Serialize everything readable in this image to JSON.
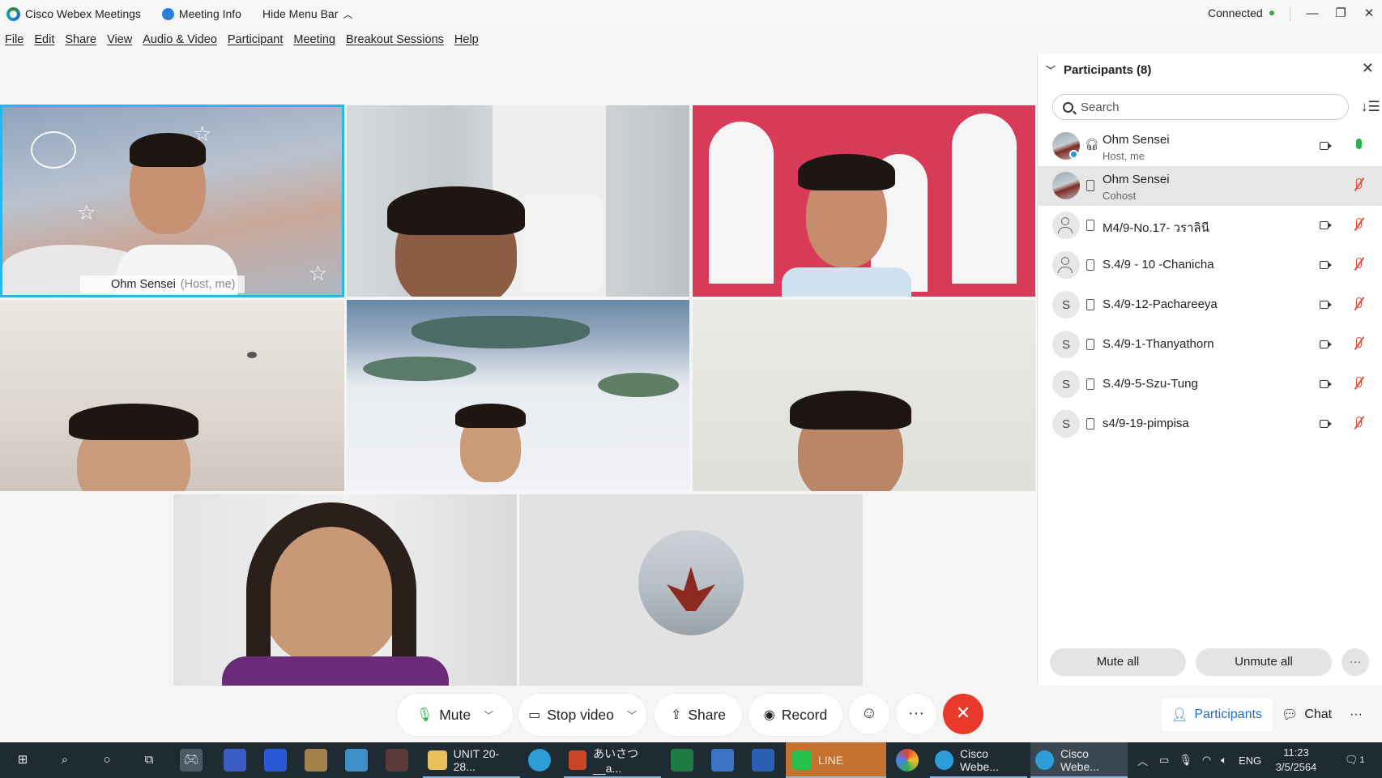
{
  "titlebar": {
    "app_name": "Cisco Webex Meetings",
    "meeting_info": "Meeting Info",
    "hide_menu_bar": "Hide Menu Bar",
    "status": "Connected",
    "status_color": "#2ca84a"
  },
  "menu": [
    "File",
    "Edit",
    "Share",
    "View",
    "Audio & Video",
    "Participant",
    "Meeting",
    "Breakout Sessions",
    "Help"
  ],
  "video": {
    "host_name": "Ohm Sensei",
    "host_tag": "(Host, me)",
    "active_border_color": "#29b6e8"
  },
  "participants_panel": {
    "title": "Participants (8)",
    "search_placeholder": "Search",
    "rows": [
      {
        "name": "Ohm Sensei",
        "role": "Host, me",
        "avatar": "photo",
        "mic": "on",
        "device": "headset"
      },
      {
        "name": "Ohm Sensei",
        "role": "Cohost",
        "avatar": "photo",
        "mic": "off",
        "device": "phone"
      },
      {
        "name": "M4/9-No.17- วราลินี",
        "role": "",
        "avatar": "person",
        "mic": "off",
        "device": "phone"
      },
      {
        "name": "S.4/9 - 10 -Chanicha",
        "role": "",
        "avatar": "person",
        "mic": "off",
        "device": "phone"
      },
      {
        "name": "S.4/9-12-Pachareeya",
        "role": "",
        "avatar": "S",
        "mic": "off",
        "device": "phone"
      },
      {
        "name": "S.4/9-1-Thanyathorn",
        "role": "",
        "avatar": "S",
        "mic": "off",
        "device": "phone"
      },
      {
        "name": "S.4/9-5-Szu-Tung",
        "role": "",
        "avatar": "S",
        "mic": "off",
        "device": "phone"
      },
      {
        "name": "s4/9-19-pimpisa",
        "role": "",
        "avatar": "S",
        "mic": "off",
        "device": "phone"
      }
    ],
    "mute_all": "Mute all",
    "unmute_all": "Unmute all",
    "more": "···"
  },
  "controls": {
    "mute": "Mute",
    "stop_video": "Stop video",
    "share": "Share",
    "record": "Record",
    "more": "···",
    "leave_icon": "✕",
    "participants": "Participants",
    "chat": "Chat",
    "right_more": "···",
    "leave_color": "#e9392a"
  },
  "taskbar": {
    "apps": [
      {
        "label": "UNIT 20-28...",
        "icon": "folder-icon"
      },
      {
        "label": "あいさつ__a...",
        "icon": "powerpoint-icon"
      },
      {
        "label": "LINE",
        "icon": "line-icon"
      },
      {
        "label": "Cisco Webe...",
        "icon": "webex-icon"
      },
      {
        "label": "Cisco Webe...",
        "icon": "webex-icon"
      }
    ],
    "language": "ENG",
    "time": "11:23",
    "date": "3/5/2564",
    "notifications": "1"
  }
}
